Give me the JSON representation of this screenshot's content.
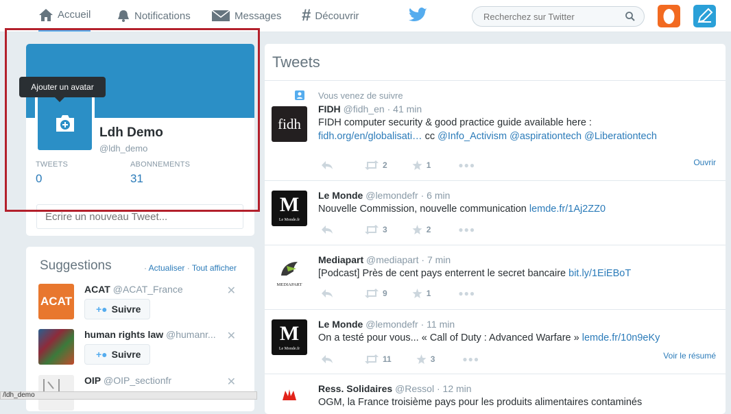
{
  "nav": {
    "home": "Accueil",
    "notifications": "Notifications",
    "messages": "Messages",
    "discover": "Découvrir",
    "search_placeholder": "Recherchez sur Twitter"
  },
  "profile": {
    "avatar_tooltip": "Ajouter un avatar",
    "name": "Ldh Demo",
    "handle": "@ldh_demo",
    "tweets_label": "TWEETS",
    "tweets_count": "0",
    "following_label": "ABONNEMENTS",
    "following_count": "31",
    "compose_placeholder": "Ecrire un nouveau Tweet..."
  },
  "suggestions": {
    "title": "Suggestions",
    "refresh": "Actualiser",
    "view_all": "Tout afficher",
    "follow_label": "Suivre",
    "items": [
      {
        "name": "ACAT",
        "handle": "@ACAT_France",
        "avatar_text": "ACAT"
      },
      {
        "name": "human rights law",
        "handle": "@humanr..."
      },
      {
        "name": "OIP",
        "handle": "@OIP_sectionfr"
      }
    ]
  },
  "tweets": {
    "title": "Tweets",
    "items": [
      {
        "context": "Vous venez de suivre",
        "name": "FIDH",
        "handle": "@fidh_en",
        "time": "41 min",
        "avatar_text": "fidh",
        "text": "FIDH computer security & good practice guide available here :",
        "text2_link": "fidh.org/en/globalisati…",
        "text2_mid": " cc ",
        "mention1": "@Info_Activism",
        "mention2": "@aspirationtech",
        "mention3": "@Liberationtech",
        "retweets": "2",
        "favorites": "1",
        "action_right": "Ouvrir"
      },
      {
        "name": "Le Monde",
        "handle": "@lemondefr",
        "time": "6 min",
        "avatar_text": "M",
        "avatar_sub": "Le Monde.fr",
        "text": "Nouvelle Commission, nouvelle communication ",
        "link": "lemde.fr/1Aj2ZZ0",
        "retweets": "3",
        "favorites": "2"
      },
      {
        "name": "Mediapart",
        "handle": "@mediapart",
        "time": "7 min",
        "avatar_text": "MEDIAPART",
        "text": "[Podcast] Près de cent pays enterrent le secret bancaire ",
        "link": "bit.ly/1EiEBoT",
        "retweets": "9",
        "favorites": "1"
      },
      {
        "name": "Le Monde",
        "handle": "@lemondefr",
        "time": "11 min",
        "avatar_text": "M",
        "avatar_sub": "Le Monde.fr",
        "text": "On a testé pour vous... « Call of Duty : Advanced Warfare » ",
        "link": "lemde.fr/10n9eKy",
        "retweets": "11",
        "favorites": "3",
        "action_right": "Voir le résumé"
      },
      {
        "name": "Ress. Solidaires",
        "handle": "@Ressol",
        "time": "12 min",
        "text": "OGM, la France troisième pays pour les produits alimentaires contaminés"
      }
    ]
  },
  "statusbar": "/ldh_demo",
  "colors": {
    "accent": "#55acee",
    "profile_blue": "#2b8fc6",
    "link": "#2b7bb9",
    "highlight_border": "#b3202c"
  }
}
